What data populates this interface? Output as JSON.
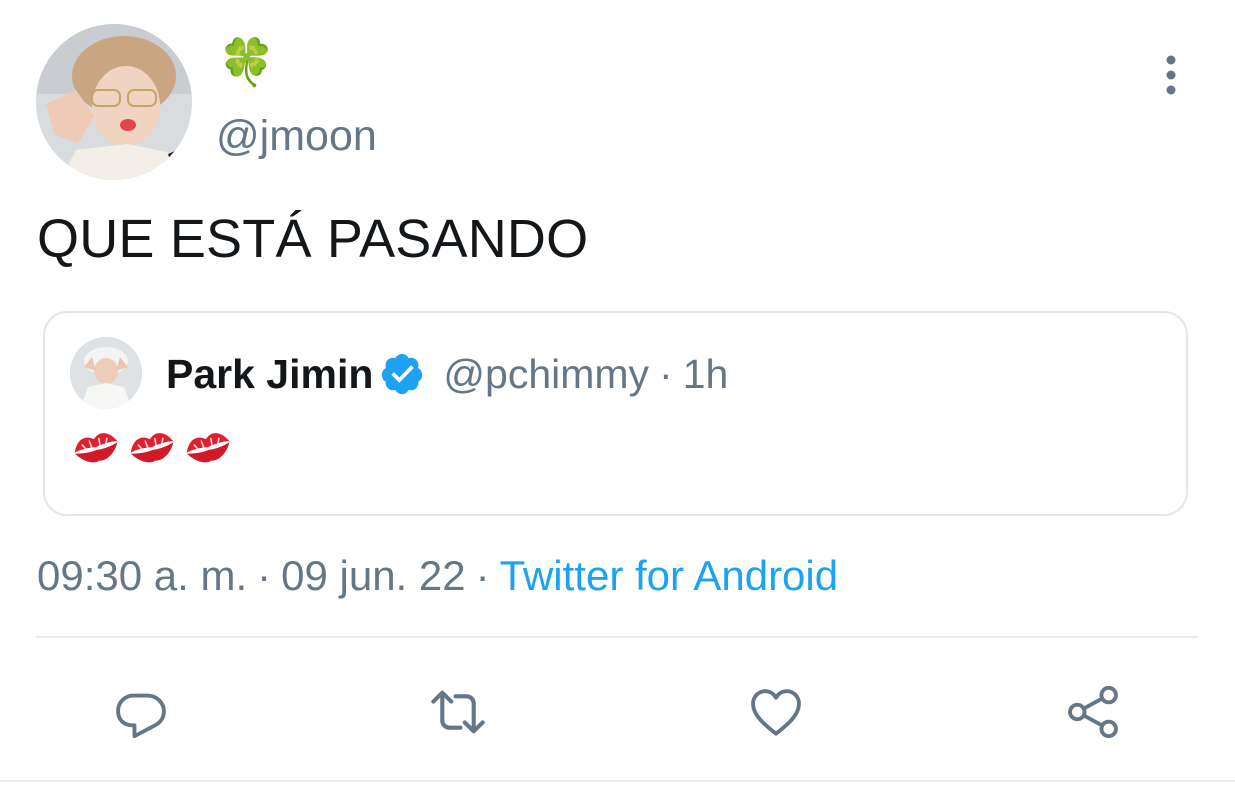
{
  "author": {
    "display_name": "🍀",
    "handle": "@jmoon",
    "avatar_icon": "profile-photo-icon"
  },
  "tweet": {
    "text": "QUE ESTÁ PASANDO"
  },
  "quoted_tweet": {
    "name": "Park Jimin",
    "verified": true,
    "handle": "@pchimmy",
    "separator": "·",
    "time": "1h",
    "body_icons": [
      "kiss-mark-icon",
      "kiss-mark-icon",
      "kiss-mark-icon"
    ]
  },
  "meta": {
    "time": "09:30 a. m.",
    "separator": "·",
    "date": "09 jun. 22",
    "source": "Twitter for Android"
  },
  "actions": {
    "reply_icon": "reply-icon",
    "retweet_icon": "retweet-icon",
    "like_icon": "heart-icon",
    "share_icon": "share-icon",
    "more_icon": "more-vertical-icon"
  },
  "colors": {
    "link": "#1da1f2",
    "secondary_text": "#657786",
    "verified": "#1da1f2",
    "border": "#e1e8ed",
    "kiss": "#e0202e"
  }
}
